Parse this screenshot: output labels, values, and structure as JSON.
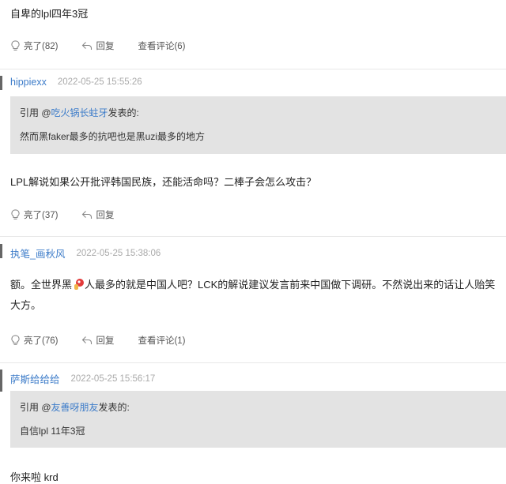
{
  "posts": [
    {
      "content": "自卑的lpl四年3冠",
      "actions": {
        "like": "亮了(82)",
        "reply": "回复",
        "view": "查看评论(6)"
      }
    },
    {
      "user": "hippiexx",
      "time": "2022-05-25 15:55:26",
      "quote": {
        "prefix": "引用 @",
        "user": "吃火锅长蛀牙",
        "suffix": "发表的:",
        "text": "然而黑faker最多的抗吧也是黑uzi最多的地方"
      },
      "content": "LPL解说如果公开批评韩国民族，还能活命吗？二棒子会怎么攻击？",
      "actions": {
        "like": "亮了(37)",
        "reply": "回复"
      }
    },
    {
      "user": "执笔_画秋风",
      "time": "2022-05-25 15:38:06",
      "content_a": "额。全世界黑",
      "content_b": "人最多的就是中国人吧？LCK的解说建议发言前来中国做下调研。不然说出来的话让人贻笑大方。",
      "actions": {
        "like": "亮了(76)",
        "reply": "回复",
        "view": "查看评论(1)"
      }
    },
    {
      "user": "萨斯给给给",
      "time": "2022-05-25 15:56:17",
      "quote": {
        "prefix": "引用 @",
        "user": "友善呀朋友",
        "suffix": "发表的:",
        "text": "自信lpl 11年3冠"
      },
      "content": "你来啦 krd"
    }
  ]
}
